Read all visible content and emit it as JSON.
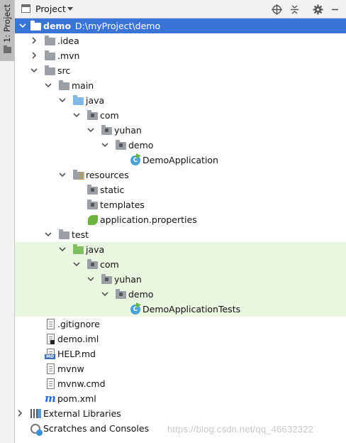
{
  "stripe": {
    "label": "1: Project"
  },
  "toolbar": {
    "title": "Project",
    "buttons": [
      "target-icon",
      "collapse-all-icon",
      "gear-icon",
      "minimize-icon"
    ]
  },
  "tree": [
    {
      "label": "demo",
      "path": "D:\\myProject\\demo",
      "bold": true,
      "icon": "module-folder-icon",
      "selected": true,
      "expanded": true
    },
    {
      "label": ".idea",
      "icon": "folder-icon"
    },
    {
      "label": ".mvn",
      "icon": "folder-icon"
    },
    {
      "label": "src",
      "icon": "folder-icon",
      "expanded": true
    },
    {
      "label": "main",
      "icon": "folder-icon",
      "expanded": true
    },
    {
      "label": "java",
      "icon": "source-root-icon",
      "expanded": true
    },
    {
      "label": "com",
      "icon": "package-icon",
      "expanded": true
    },
    {
      "label": "yuhan",
      "icon": "package-icon",
      "expanded": true
    },
    {
      "label": "demo",
      "icon": "package-icon",
      "expanded": true
    },
    {
      "label": "DemoApplication",
      "icon": "spring-boot-class-icon"
    },
    {
      "label": "resources",
      "icon": "resources-root-icon",
      "expanded": true
    },
    {
      "label": "static",
      "icon": "folder-icon"
    },
    {
      "label": "templates",
      "icon": "folder-icon"
    },
    {
      "label": "application.properties",
      "icon": "spring-properties-icon"
    },
    {
      "label": "test",
      "icon": "folder-icon",
      "expanded": true
    },
    {
      "label": "java",
      "icon": "test-root-icon",
      "expanded": true
    },
    {
      "label": "com",
      "icon": "package-icon",
      "expanded": true
    },
    {
      "label": "yuhan",
      "icon": "package-icon",
      "expanded": true
    },
    {
      "label": "demo",
      "icon": "package-icon",
      "expanded": true
    },
    {
      "label": "DemoApplicationTests",
      "icon": "test-class-icon"
    },
    {
      "label": ".gitignore",
      "icon": "text-file-icon"
    },
    {
      "label": "demo.iml",
      "icon": "iml-file-icon"
    },
    {
      "label": "HELP.md",
      "icon": "markdown-file-icon"
    },
    {
      "label": "mvnw",
      "icon": "text-file-icon"
    },
    {
      "label": "mvnw.cmd",
      "icon": "text-file-icon"
    },
    {
      "label": "pom.xml",
      "icon": "maven-icon"
    },
    {
      "label": "External Libraries",
      "icon": "libraries-icon"
    },
    {
      "label": "Scratches and Consoles",
      "icon": "scratches-icon"
    }
  ],
  "watermark": "https://blog.csdn.net/qq_46632322",
  "colors": {
    "selection": "#3a74d7",
    "test_highlight": "#eaf6df",
    "source_folder": "#80b8e6",
    "test_folder": "#7fbf5e"
  }
}
